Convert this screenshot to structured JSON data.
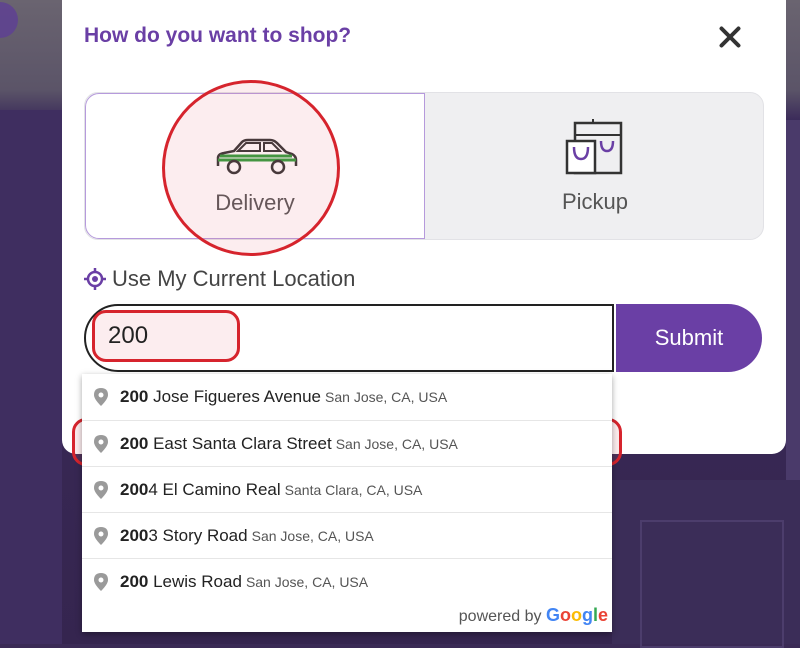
{
  "modal": {
    "title": "How do you want to shop?",
    "close_icon": "close-icon"
  },
  "options": {
    "delivery": {
      "label": "Delivery",
      "icon": "car-icon",
      "selected": true
    },
    "pickup": {
      "label": "Pickup",
      "icon": "shopping-bag-icon",
      "selected": false
    }
  },
  "location": {
    "use_current_label": "Use My Current Location",
    "icon": "location-target-icon"
  },
  "search": {
    "value": "200",
    "submit_label": "Submit"
  },
  "suggestions": [
    {
      "bold": "200",
      "rest": " Jose Figueres Avenue",
      "sub": "San Jose, CA, USA"
    },
    {
      "bold": "200",
      "rest": " East Santa Clara Street",
      "sub": "San Jose, CA, USA"
    },
    {
      "bold": "200",
      "rest": "4 El Camino Real",
      "sub": "Santa Clara, CA, USA"
    },
    {
      "bold": "200",
      "rest": "3 Story Road",
      "sub": "San Jose, CA, USA"
    },
    {
      "bold": "200",
      "rest": " Lewis Road",
      "sub": "San Jose, CA, USA"
    }
  ],
  "attribution": {
    "prefix": "powered by",
    "brand_letters": [
      "G",
      "o",
      "o",
      "g",
      "l",
      "e"
    ],
    "brand_colors": [
      "#4285F4",
      "#EA4335",
      "#FBBC05",
      "#4285F4",
      "#34A853",
      "#EA4335"
    ]
  },
  "colors": {
    "accent": "#6a3fa5",
    "highlight": "#d6242d",
    "car": "#2e9b3a"
  }
}
